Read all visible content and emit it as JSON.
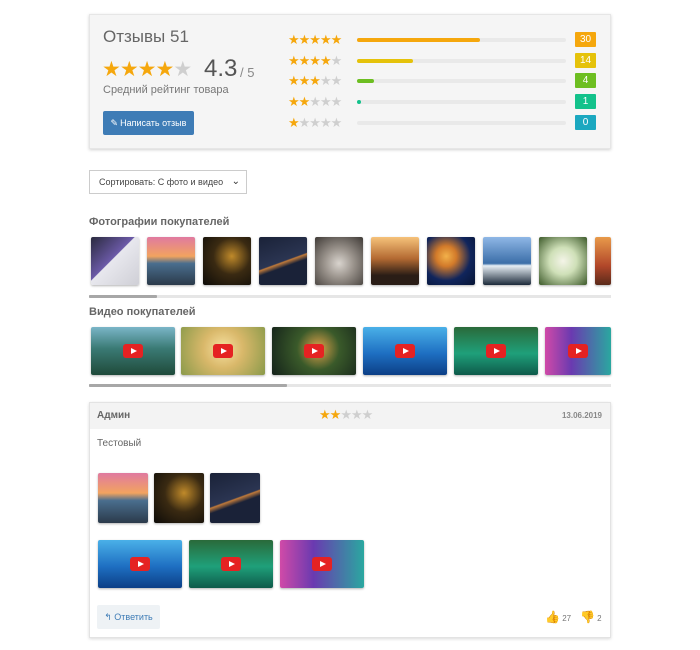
{
  "summary": {
    "title": "Отзывы 51",
    "average": "4.3",
    "out_of": "/ 5",
    "average_label": "Средний рейтинг товара",
    "write_button": "Написать отзыв",
    "rating_stars": 4,
    "rows": [
      {
        "stars": 5,
        "count": "30",
        "fraction": 0.59,
        "color": "#f5a70d"
      },
      {
        "stars": 4,
        "count": "14",
        "fraction": 0.27,
        "color": "#e5c20a"
      },
      {
        "stars": 3,
        "count": "4",
        "fraction": 0.08,
        "color": "#6dbe21"
      },
      {
        "stars": 2,
        "count": "1",
        "fraction": 0.02,
        "color": "#13c28b"
      },
      {
        "stars": 1,
        "count": "0",
        "fraction": 0.0,
        "color": "#1ba8c0"
      }
    ]
  },
  "sort": {
    "selected": "Сортировать: С фото и видео"
  },
  "photos_section": {
    "title": "Фотографии покупателей",
    "items": [
      "laptop",
      "pier-sunset",
      "dark-landscape",
      "dancer",
      "koala",
      "pine-trees",
      "jellyfish",
      "penguins",
      "hydrangea",
      "autumn"
    ],
    "scroll_fraction": 0.13
  },
  "videos_section": {
    "title": "Видео покупателей",
    "items": [
      "jungle",
      "meditation",
      "fairy-forest",
      "dolphins",
      "tropical-river",
      "waterfall"
    ],
    "scroll_fraction": 0.38
  },
  "review": {
    "author": "Админ",
    "stars": 2,
    "date": "13.06.2019",
    "text": "Тестовый",
    "reply_label": "Ответить",
    "likes": "27",
    "dislikes": "2",
    "photos": [
      "pier-sunset",
      "dark-landscape",
      "dancer"
    ],
    "videos": [
      "dolphins",
      "tropical-river",
      "waterfall"
    ]
  },
  "colors": {
    "star": "#f5a70d",
    "accent": "#3e7cb6"
  }
}
